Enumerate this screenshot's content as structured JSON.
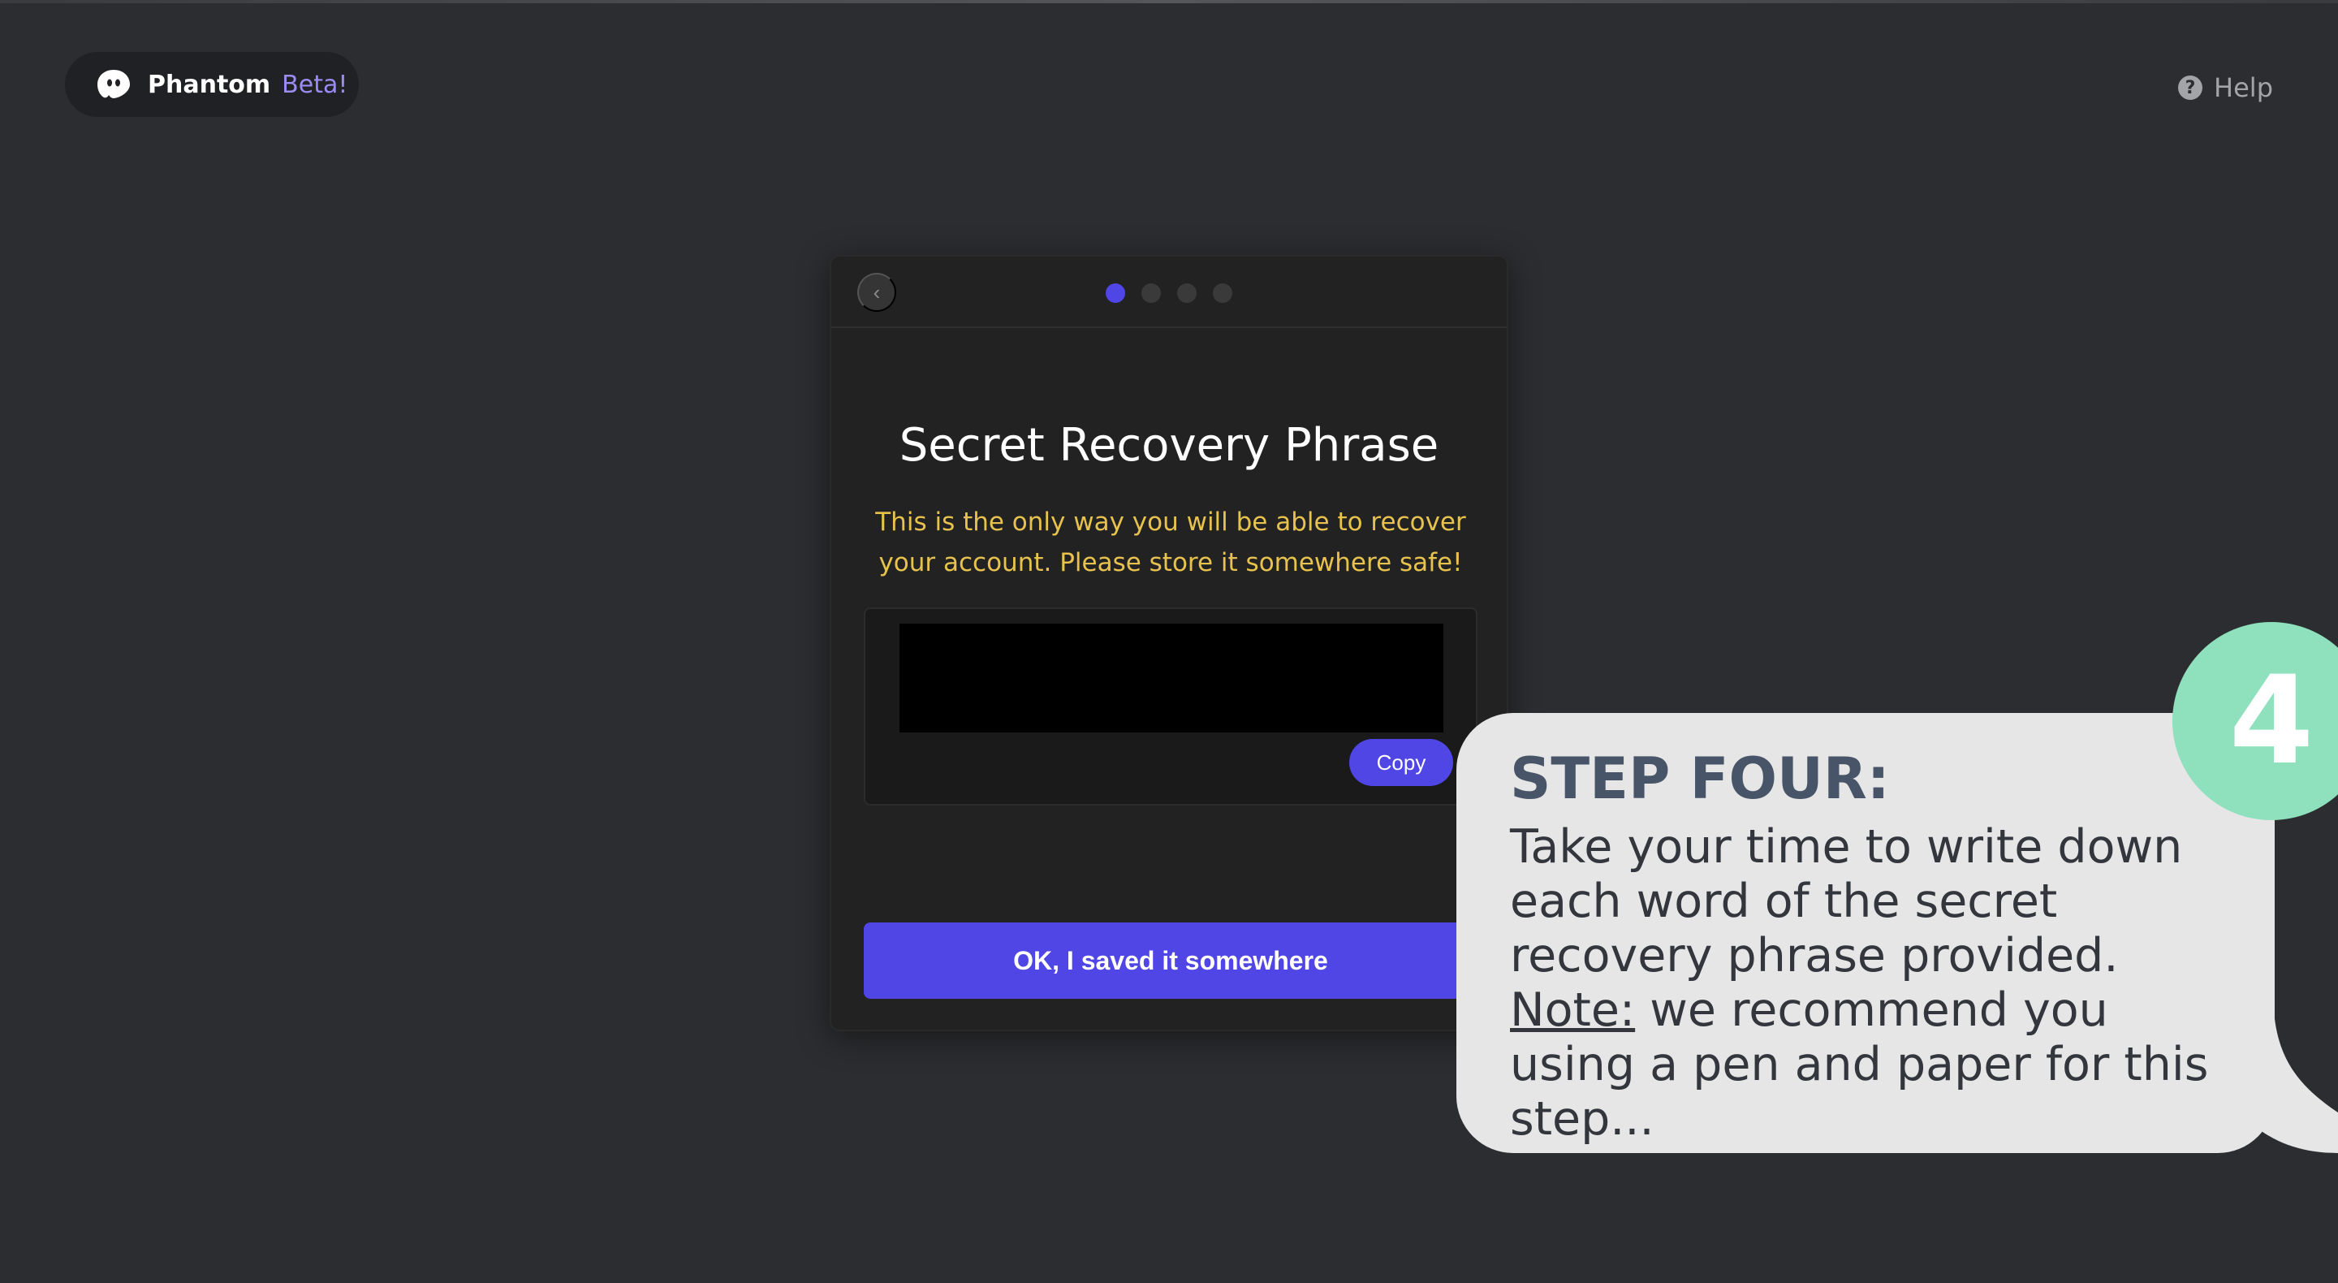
{
  "brand": {
    "name": "Phantom",
    "badge": "Beta!",
    "icon": "ghost-icon"
  },
  "help": {
    "icon": "question-circle-icon",
    "icon_glyph": "?",
    "label": "Help"
  },
  "dialog": {
    "back_icon": "chevron-left-icon",
    "back_glyph": "‹",
    "steps_total": 4,
    "current_step": 1,
    "title": "Secret Recovery Phrase",
    "warning": "This is the only way you will be able to recover your account. Please store it somewhere safe!",
    "copy_label": "Copy",
    "confirm_label": "OK, I saved it somewhere"
  },
  "tutorial": {
    "step_number": "4",
    "step_title": "STEP FOUR:",
    "body": "Take your time to write down each word of the secret recovery phrase provided.",
    "note_label": "Note:",
    "note_text": "we recommend you using a pen and paper for this step..."
  },
  "colors": {
    "background": "#2c2d30",
    "accent": "#4f46e5",
    "warning": "#e8c24e",
    "badge": "#9b8cf5",
    "bubble": "#e6e6e6",
    "step_circle": "#8fe0bd"
  }
}
